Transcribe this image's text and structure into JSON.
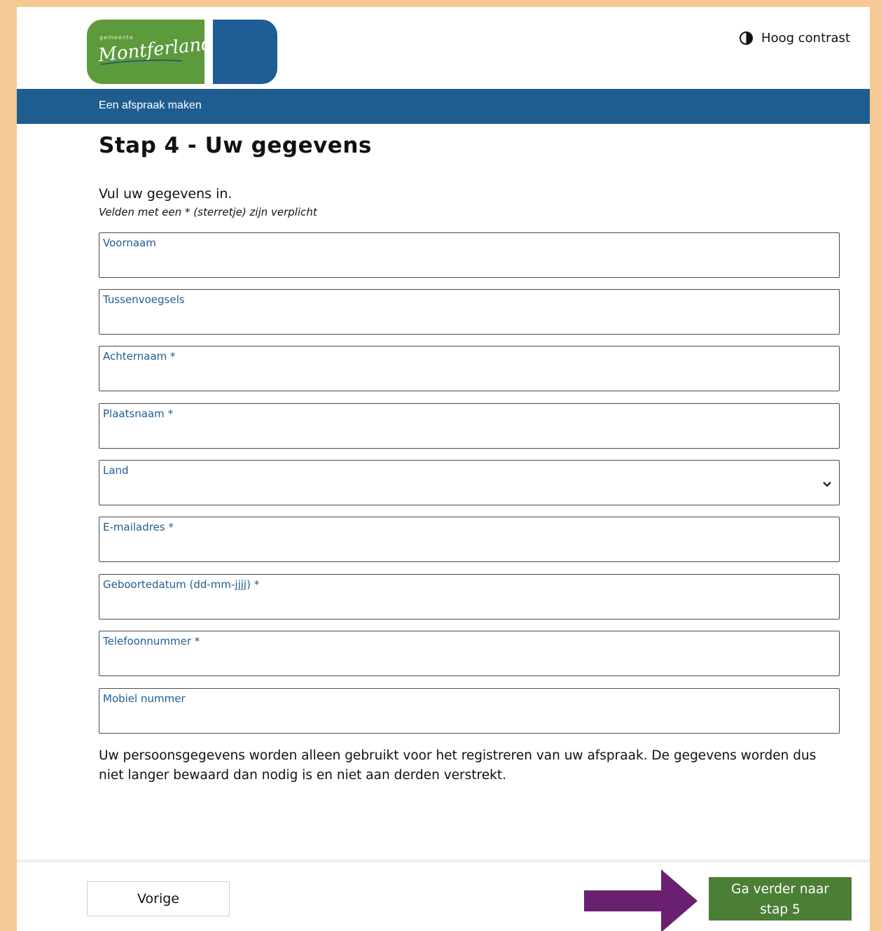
{
  "header": {
    "logo_small": "gemeente",
    "logo_script": "Montferland",
    "contrast_label": "Hoog contrast"
  },
  "nav": {
    "title": "Een afspraak maken"
  },
  "page": {
    "title": "Stap 4 - Uw gegevens",
    "intro": "Vul uw gegevens in.",
    "hint": "Velden met een * (sterretje) zijn verplicht"
  },
  "fields": [
    {
      "label": "Voornaam",
      "value": ""
    },
    {
      "label": "Tussenvoegsels",
      "value": ""
    },
    {
      "label": "Achternaam *",
      "value": ""
    },
    {
      "label": "Plaatsnaam *",
      "value": ""
    },
    {
      "label": "Land",
      "value": ""
    },
    {
      "label": "E-mailadres *",
      "value": ""
    },
    {
      "label": "Geboortedatum (dd-mm-jjjj) *",
      "value": ""
    },
    {
      "label": "Telefoonnummer *",
      "value": ""
    },
    {
      "label": "Mobiel nummer",
      "value": ""
    }
  ],
  "privacy": "Uw persoonsgegevens worden alleen gebruikt voor het registreren van uw afspraak. De gegevens worden dus niet langer bewaard dan nodig is en niet aan derden verstrekt.",
  "footer": {
    "prev_label": "Vorige",
    "next_label_1": "Ga verder naar",
    "next_label_2": "stap 5"
  },
  "colors": {
    "frame": "#f6c994",
    "brand_blue": "#1f5d91",
    "brand_green": "#5c9a3c",
    "next_button": "#4c7f36",
    "annotation_arrow": "#6a2070"
  },
  "icons": {
    "contrast": "contrast-icon",
    "select": "chevron-down-icon",
    "arrow": "arrow-right-icon"
  }
}
